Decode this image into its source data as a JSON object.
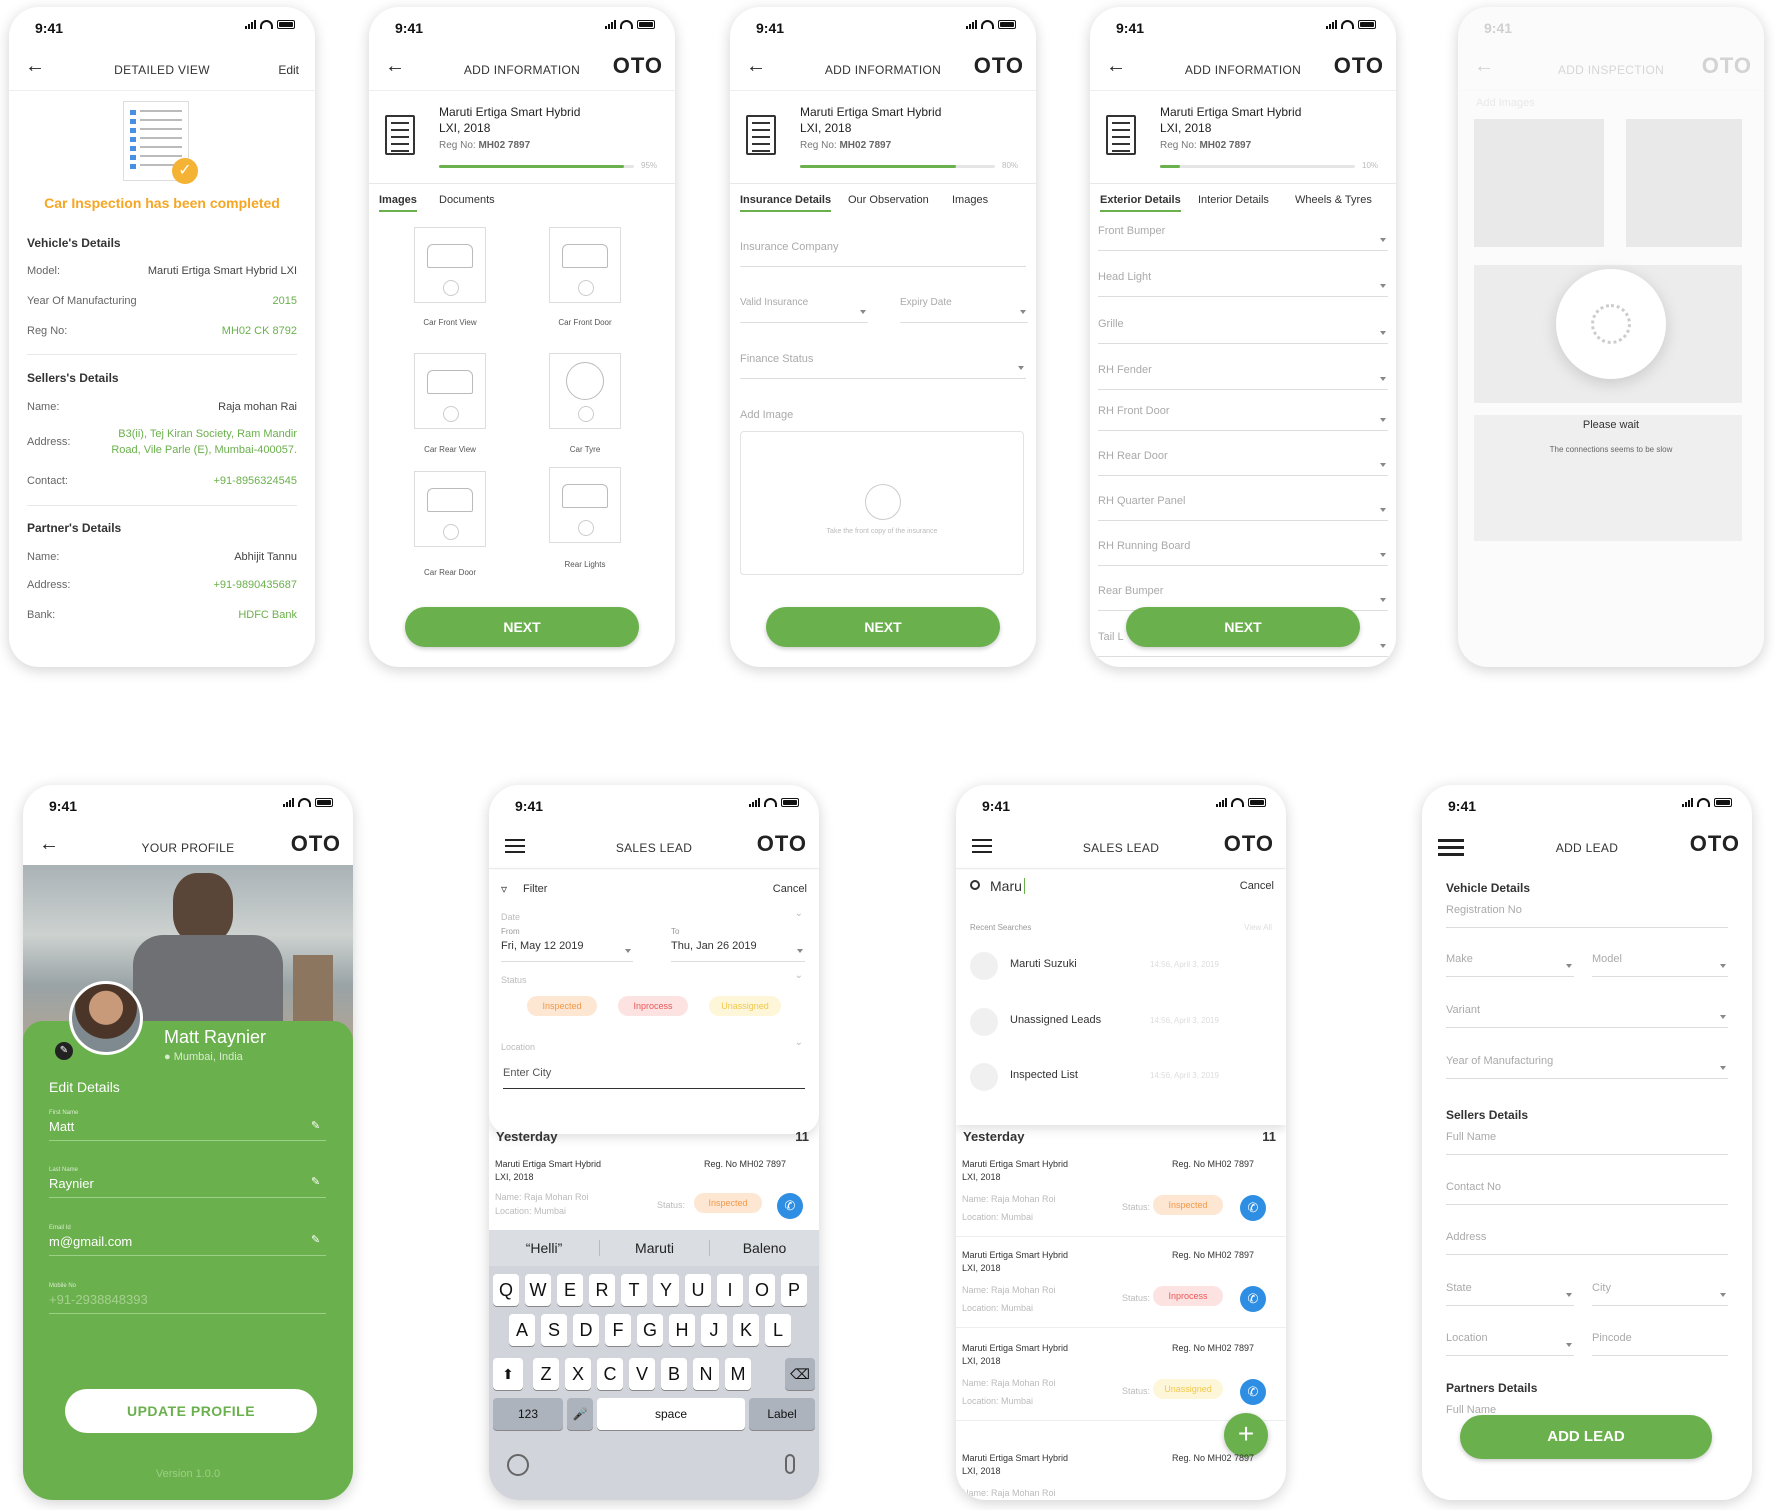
{
  "status_time": "9:41",
  "logo_text": "OTO",
  "accent": "#6ab04c",
  "screen1": {
    "title": "DETAILED VIEW",
    "edit": "Edit",
    "banner": "Car Inspection has been completed",
    "vehicle_header": "Vehicle's Details",
    "model_label": "Model:",
    "model_value": "Maruti Ertiga Smart Hybrid LXI",
    "year_label": "Year Of Manufacturing",
    "year_value": "2015",
    "reg_label": "Reg No:",
    "reg_value": "MH02 CK 8792",
    "sellers_header": "Sellers's Details",
    "s_name_label": "Name:",
    "s_name_value": "Raja mohan Rai",
    "s_addr_label": "Address:",
    "s_addr_value1": "B3(ii), Tej Kiran Society, Ram Mandir",
    "s_addr_value2": "Road, Vile Parle (E), Mumbai-400057.",
    "s_contact_label": "Contact:",
    "s_contact_value": "+91-8956324545",
    "partner_header": "Partner's Details",
    "p_name_label": "Name:",
    "p_name_value": "Abhijit Tannu",
    "p_addr_label": "Address:",
    "p_addr_value": "+91-9890435687",
    "p_bank_label": "Bank:",
    "p_bank_value": "HDFC Bank"
  },
  "car_card": {
    "name1": "Maruti Ertiga Smart Hybrid",
    "name2": "LXI, 2018",
    "reg_label": "Reg No: ",
    "reg_value": "MH02 7897"
  },
  "screen2": {
    "title": "ADD INFORMATION",
    "progress_label": "95%",
    "progress": 0.95,
    "tabs": [
      "Images",
      "Documents"
    ],
    "images": [
      "Car Front View",
      "Car Front Door",
      "Car Rear View",
      "Car Tyre",
      "Car Rear Door",
      "Rear Lights"
    ],
    "next": "NEXT"
  },
  "screen3": {
    "title": "ADD INFORMATION",
    "progress_label": "80%",
    "progress": 0.8,
    "tabs": [
      "Insurance Details",
      "Our Observation",
      "Images"
    ],
    "insurance_company": "Insurance Company",
    "valid_insurance": "Valid Insurance",
    "expiry_date": "Expiry Date",
    "finance_status": "Finance Status",
    "add_image": "Add Image",
    "upload_hint": "Take the front copy of the insurance",
    "next": "NEXT"
  },
  "screen4": {
    "title": "ADD INFORMATION",
    "progress_label": "10%",
    "progress": 0.1,
    "tabs": [
      "Exterior Details",
      "Interior Details",
      "Wheels & Tyres"
    ],
    "fields": [
      "Front Bumper",
      "Head Light",
      "Grille",
      "RH Fender",
      "RH Front Door",
      "RH Rear Door",
      "RH Quarter Panel",
      "RH Running Board",
      "Rear Bumper",
      "Tail L"
    ],
    "next": "NEXT"
  },
  "screen5": {
    "faded_title": "ADD INSPECTION",
    "faded_add_images": "Add Images",
    "please_wait": "Please wait",
    "slow": "The connections seems to be slow"
  },
  "profile": {
    "title": "YOUR PROFILE",
    "name": "Matt Raynier",
    "location": "Mumbai, India",
    "edit_details": "Edit Details",
    "first_name_label": "First Name",
    "first_name": "Matt",
    "last_name_label": "Last Name",
    "last_name": "Raynier",
    "email_label": "Email Id",
    "email": "m@gmail.com",
    "mobile_label": "Mobile No",
    "mobile": "+91-2938848393",
    "update": "UPDATE PROFILE",
    "version": "Version 1.0.0"
  },
  "filter": {
    "title": "SALES LEAD",
    "filter": "Filter",
    "cancel": "Cancel",
    "date": "Date",
    "from": "From",
    "from_value": "Fri, May 12 2019",
    "to": "To",
    "to_value": "Thu, Jan 26 2019",
    "status": "Status",
    "chips": [
      "Inspected",
      "Inprocess",
      "Unassigned"
    ],
    "location": "Location",
    "city": "Enter City",
    "yesterday": "Yesterday",
    "count": "11",
    "lead_name1": "Maruti Ertiga Smart Hybrid",
    "lead_name2": "LXI, 2018",
    "lead_reg": "Reg. No MH02 7897",
    "lead_owner": "Name: Raja Mohan Roi",
    "lead_loc": "Location: Mumbai",
    "status_label": "Status:",
    "status_value": "Inspected",
    "suggestions": [
      "“Helli”",
      "Maruti",
      "Baleno"
    ],
    "row1": [
      "Q",
      "W",
      "E",
      "R",
      "T",
      "Y",
      "U",
      "I",
      "O",
      "P"
    ],
    "row2": [
      "A",
      "S",
      "D",
      "F",
      "G",
      "H",
      "J",
      "K",
      "L"
    ],
    "row3": [
      "Z",
      "X",
      "C",
      "V",
      "B",
      "N",
      "M"
    ],
    "k123": "123",
    "space": "space",
    "label": "Label"
  },
  "search": {
    "title": "SALES LEAD",
    "query": "Maru",
    "cancel": "Cancel",
    "recent": "Recent Searches",
    "view_all": "View All",
    "items": [
      {
        "text": "Maruti Suzuki",
        "time": "14:56, April 3, 2019"
      },
      {
        "text": "Unassigned Leads",
        "time": "14:56, April 3, 2019"
      },
      {
        "text": "Inspected List",
        "time": "14:56, April 3, 2019"
      }
    ],
    "yesterday": "Yesterday",
    "count": "11",
    "leads": [
      {
        "name1": "Maruti Ertiga Smart Hybrid",
        "name2": "LXI, 2018",
        "reg": "Reg. No MH02 7897",
        "owner": "Name: Raja Mohan Roi",
        "loc": "Location: Mumbai",
        "status_label": "Status:",
        "status": "Inspected"
      },
      {
        "name1": "Maruti Ertiga Smart Hybrid",
        "name2": "LXI, 2018",
        "reg": "Reg. No MH02 7897",
        "owner": "Name: Raja Mohan Roi",
        "loc": "Location: Mumbai",
        "status_label": "Status:",
        "status": "Inprocess"
      },
      {
        "name1": "Maruti Ertiga Smart Hybrid",
        "name2": "LXI, 2018",
        "reg": "Reg. No MH02 7897",
        "owner": "Name: Raja Mohan Roi",
        "loc": "Location: Mumbai",
        "status_label": "Status:",
        "status": "Unassigned"
      },
      {
        "name1": "Maruti Ertiga Smart Hybrid",
        "name2": "LXI, 2018",
        "reg": "Reg. No MH02 7897",
        "owner": "Name: Raja Mohan Roi",
        "loc": "",
        "status_label": "",
        "status": ""
      }
    ]
  },
  "addlead": {
    "title": "ADD LEAD",
    "vehicle": "Vehicle Details",
    "reg": "Registration No",
    "make": "Make",
    "model": "Model",
    "variant": "Variant",
    "year": "Year of Manufacturing",
    "sellers": "Sellers Details",
    "full_name": "Full Name",
    "contact": "Contact No",
    "address": "Address",
    "state": "State",
    "city": "City",
    "location": "Location",
    "pincode": "Pincode",
    "partners": "Partners Details",
    "partner_full_name": "Full Name",
    "add": "ADD LEAD"
  }
}
